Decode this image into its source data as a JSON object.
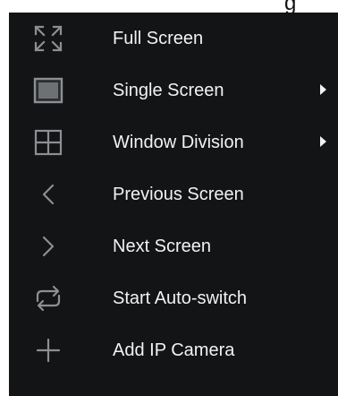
{
  "menu": {
    "items": [
      {
        "label": "Full Screen",
        "icon": "full-screen-icon",
        "has_submenu": false
      },
      {
        "label": "Single Screen",
        "icon": "single-screen-icon",
        "has_submenu": true
      },
      {
        "label": "Window Division",
        "icon": "window-division-icon",
        "has_submenu": true
      },
      {
        "label": "Previous Screen",
        "icon": "chevron-left-icon",
        "has_submenu": false
      },
      {
        "label": "Next Screen",
        "icon": "chevron-right-icon",
        "has_submenu": false
      },
      {
        "label": "Start Auto-switch",
        "icon": "auto-switch-icon",
        "has_submenu": false
      },
      {
        "label": "Add IP Camera",
        "icon": "plus-icon",
        "has_submenu": false
      }
    ]
  },
  "colors": {
    "menu_background": "#131415",
    "text": "#f2f2f2",
    "icon": "#8c8f93",
    "icon_fill": "#6e7174"
  }
}
